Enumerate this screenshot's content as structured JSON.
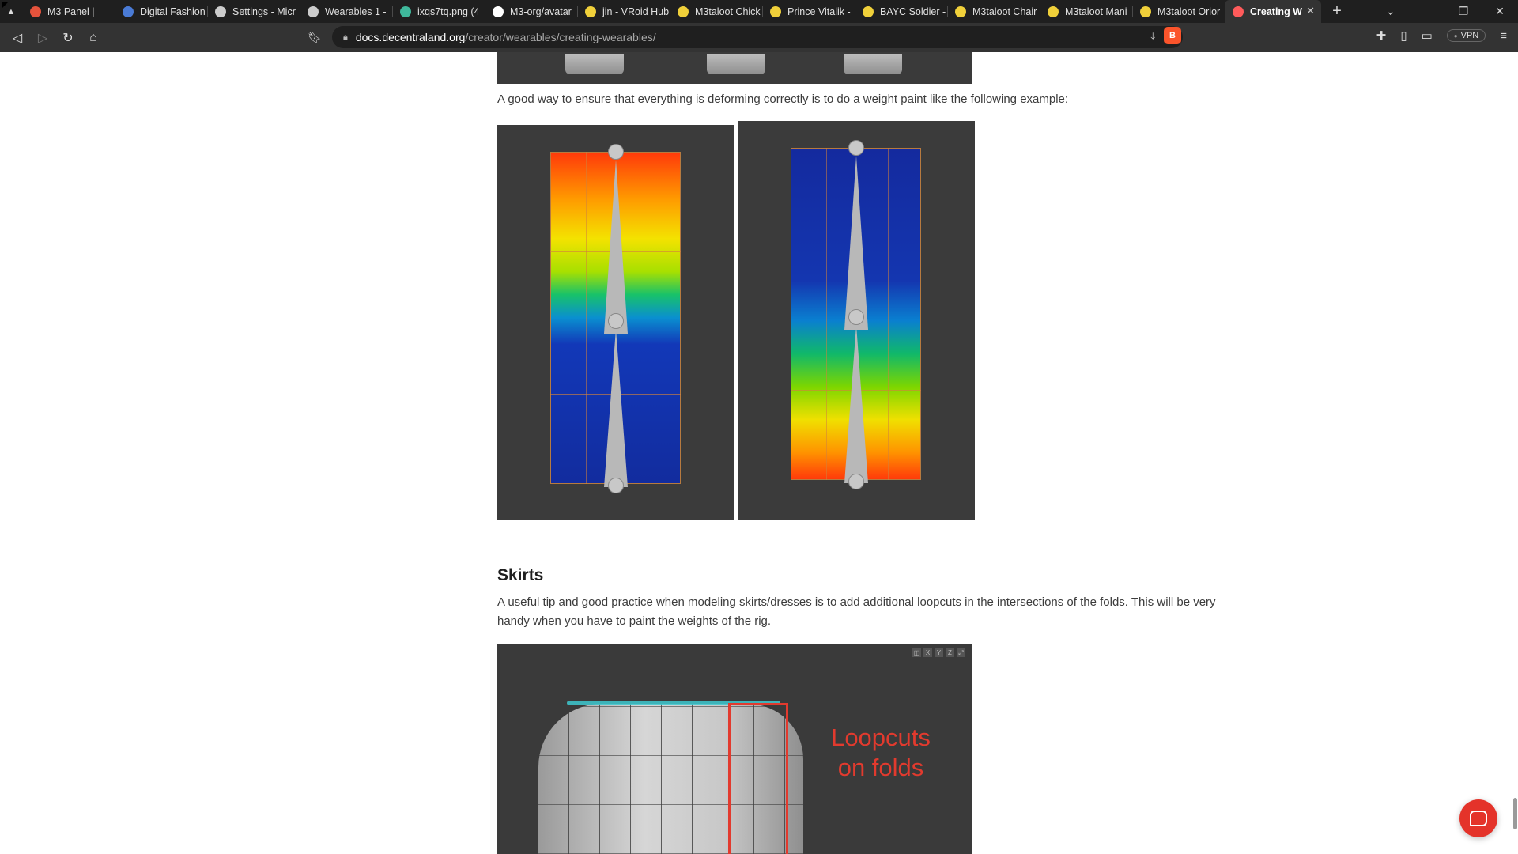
{
  "browser": {
    "tabs": [
      {
        "title": "M3 Panel | ",
        "icon": "record-icon",
        "color": "#e5533c"
      },
      {
        "title": "Digital Fashion",
        "icon": "docs-icon",
        "color": "#4a7bd6"
      },
      {
        "title": "Settings - Micr",
        "icon": "gear-icon",
        "color": "#cccccc"
      },
      {
        "title": "Wearables 1 - ",
        "icon": "page-icon",
        "color": "#cccccc"
      },
      {
        "title": "ixqs7tq.png (4",
        "icon": "image-icon",
        "color": "#3fb89b"
      },
      {
        "title": "M3-org/avatar",
        "icon": "github-icon",
        "color": "#ffffff"
      },
      {
        "title": "jin - VRoid Hub",
        "icon": "vroid-icon",
        "color": "#f0d03a"
      },
      {
        "title": "M3taloot Chick",
        "icon": "vroid-icon",
        "color": "#f0d03a"
      },
      {
        "title": "Prince Vitalik -",
        "icon": "vroid-icon",
        "color": "#f0d03a"
      },
      {
        "title": "BAYC Soldier -",
        "icon": "vroid-icon",
        "color": "#f0d03a"
      },
      {
        "title": "M3taloot Chair",
        "icon": "vroid-icon",
        "color": "#f0d03a"
      },
      {
        "title": "M3taloot Mani",
        "icon": "vroid-icon",
        "color": "#f0d03a"
      },
      {
        "title": "M3taloot Orior",
        "icon": "vroid-icon",
        "color": "#f0d03a"
      },
      {
        "title": "Creating W",
        "icon": "decentraland-icon",
        "color": "#ff5b5b",
        "active": true
      }
    ],
    "url_host": "docs.decentraland.org",
    "url_path": "/creator/wearables/creating-wearables/",
    "vpn_label": "VPN"
  },
  "content": {
    "weight_paint_intro": "A good way to ensure that everything is deforming correctly is to do a weight paint like the following example:",
    "skirts_heading": "Skirts",
    "skirts_text": "A useful tip and good practice when modeling skirts/dresses is to add additional loopcuts in the intersections of the folds. This will be very handy when you have to paint the weights of the rig.",
    "skirt_annotation_line1": "Loopcuts",
    "skirt_annotation_line2": "on folds",
    "viewport_axes": [
      "X",
      "Y",
      "Z"
    ]
  },
  "colors": {
    "annotation_red": "#e23a2e",
    "chat_button": "#e4332a"
  }
}
